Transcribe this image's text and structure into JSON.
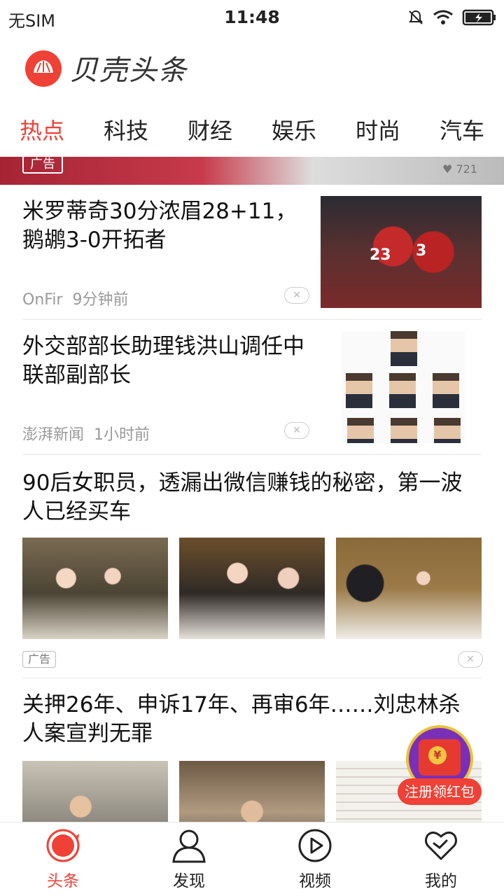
{
  "status_bar": {
    "carrier": "无SIM",
    "time": "11:48"
  },
  "header": {
    "app_name": "贝壳头条"
  },
  "categories": [
    "热点",
    "科技",
    "财经",
    "娱乐",
    "时尚",
    "汽车"
  ],
  "active_category": "热点",
  "ad_strip": {
    "badge": "广告",
    "likes": "721"
  },
  "articles": [
    {
      "title": "米罗蒂奇30分浓眉28+11，鹅鹕3-0开拓者",
      "source": "OnFir",
      "time": "9分钟前"
    },
    {
      "title": "外交部部长助理钱洪山调任中联部副部长",
      "source": "澎湃新闻",
      "time": "1小时前"
    },
    {
      "title": "90后女职员，透漏出微信赚钱的秘密，第一波人已经买车",
      "badge": "广告"
    },
    {
      "title": "关押26年、申诉17年、再审6年……刘忠林杀人案宣判无罪"
    }
  ],
  "red_packet": {
    "coin": "¥",
    "label": "注册领红包"
  },
  "bottom_nav": [
    {
      "label": "头条",
      "icon": "headlines-icon"
    },
    {
      "label": "发现",
      "icon": "discover-icon"
    },
    {
      "label": "视频",
      "icon": "video-play-icon"
    },
    {
      "label": "我的",
      "icon": "heart-profile-icon"
    }
  ],
  "colors": {
    "accent": "#ef4136",
    "text": "#111111",
    "meta": "#999999"
  }
}
